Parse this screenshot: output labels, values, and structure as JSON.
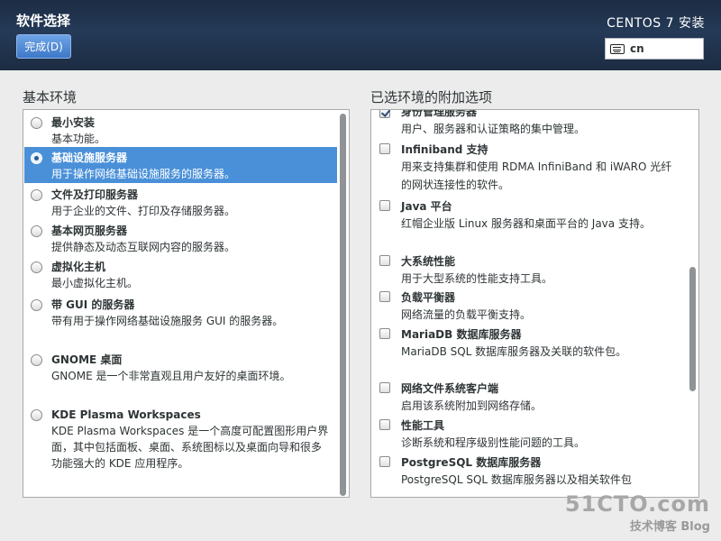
{
  "header": {
    "title": "软件选择",
    "done_label": "完成(D)",
    "product": "CENTOS 7 安装",
    "keyboard_layout": "cn"
  },
  "base_env": {
    "label": "基本环境",
    "items": [
      {
        "name": "最小安装",
        "desc": "基本功能。",
        "selected": false
      },
      {
        "name": "基础设施服务器",
        "desc": "用于操作网络基础设施服务的服务器。",
        "selected": true
      },
      {
        "name": "文件及打印服务器",
        "desc": "用于企业的文件、打印及存储服务器。",
        "selected": false
      },
      {
        "name": "基本网页服务器",
        "desc": "提供静态及动态互联网内容的服务器。",
        "selected": false
      },
      {
        "name": "虚拟化主机",
        "desc": "最小虚拟化主机。",
        "selected": false
      },
      {
        "name": "带 GUI 的服务器",
        "desc": "带有用于操作网络基础设施服务 GUI 的服务器。",
        "selected": false
      },
      {
        "name": "GNOME 桌面",
        "desc": "GNOME 是一个非常直观且用户友好的桌面环境。",
        "selected": false
      },
      {
        "name": "KDE Plasma Workspaces",
        "desc": "KDE Plasma Workspaces 是一个高度可配置图形用户界面，其中包括面板、桌面、系统图标以及桌面向导和很多功能强大的 KDE 应用程序。",
        "selected": false
      }
    ]
  },
  "addons": {
    "label": "已选环境的附加选项",
    "items": [
      {
        "name": "身份管理服务器",
        "desc": "用户、服务器和认证策略的集中管理。",
        "checked": true
      },
      {
        "name": "Infiniband 支持",
        "desc": "用来支持集群和使用 RDMA InfiniBand 和 iWARO 光纤的网状连接性的软件。",
        "checked": false
      },
      {
        "name": "Java 平台",
        "desc": "红帽企业版 Linux 服务器和桌面平台的 Java 支持。",
        "checked": false
      },
      {
        "name": "大系统性能",
        "desc": "用于大型系统的性能支持工具。",
        "checked": false
      },
      {
        "name": "负载平衡器",
        "desc": "网络流量的负载平衡支持。",
        "checked": false
      },
      {
        "name": "MariaDB 数据库服务器",
        "desc": "MariaDB SQL 数据库服务器及关联的软件包。",
        "checked": false
      },
      {
        "name": "网络文件系统客户端",
        "desc": "启用该系统附加到网络存储。",
        "checked": false
      },
      {
        "name": "性能工具",
        "desc": "诊断系统和程序级别性能问题的工具。",
        "checked": false
      },
      {
        "name": "PostgreSQL 数据库服务器",
        "desc": "PostgreSQL SQL 数据库服务器以及相关软件包",
        "checked": false
      }
    ]
  },
  "watermark": {
    "site": "51CTO.com",
    "sub": "技术博客",
    "blog": "Blog"
  },
  "colors": {
    "header_bg": "#1d2d44",
    "selection": "#4a90d9",
    "button": "#3d78c8"
  }
}
